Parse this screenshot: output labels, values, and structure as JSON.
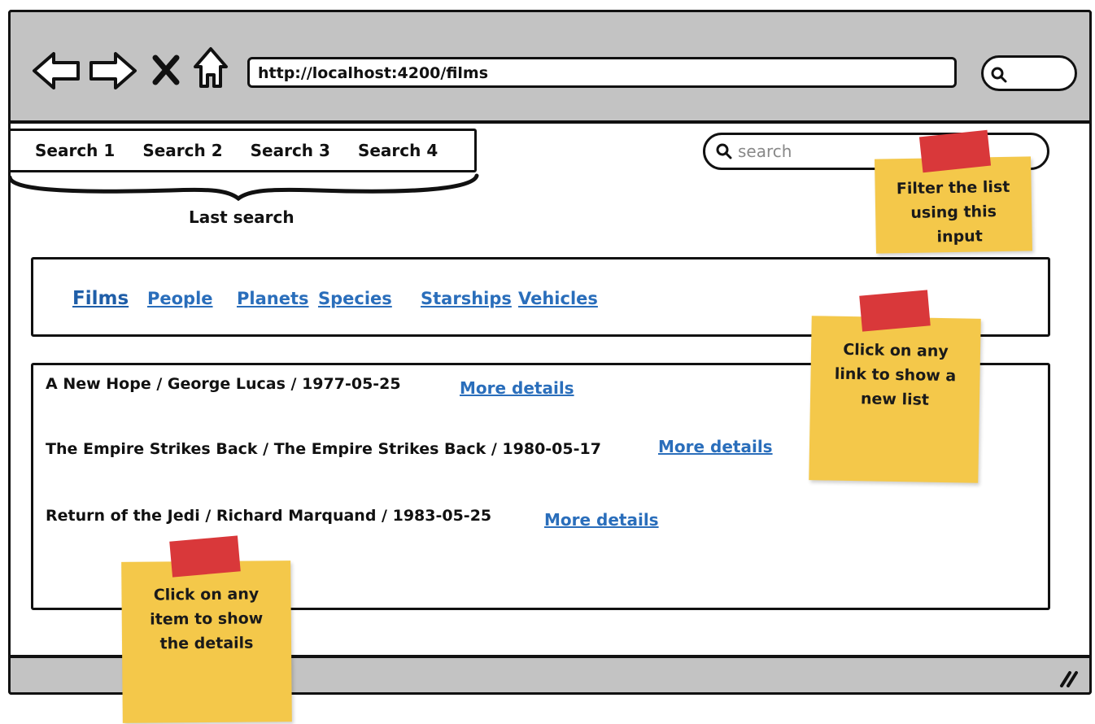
{
  "browser": {
    "url": "http://localhost:4200/films",
    "nav_icons": [
      "back-arrow-icon",
      "forward-arrow-icon",
      "stop-icon",
      "home-icon"
    ],
    "search_icon": "search-icon"
  },
  "recent_searches": {
    "items": [
      "Search 1",
      "Search 2",
      "Search 3",
      "Search 4"
    ],
    "caption": "Last search"
  },
  "search": {
    "placeholder": "search"
  },
  "categories": {
    "links": [
      "Films",
      "People",
      "Planets",
      "Species",
      "Starships",
      "Vehicles"
    ],
    "active": "Films"
  },
  "films": {
    "rows": [
      "A New Hope / George Lucas / 1977-05-25",
      "The Empire Strikes Back / The Empire Strikes Back / 1980-05-17",
      "Return of the Jedi / Richard Marquand / 1983-05-25"
    ],
    "more_label": "More details"
  },
  "notes": {
    "filter": [
      "Filter the list",
      "using this",
      "input"
    ],
    "links": [
      "Click on any",
      "link to show a",
      "new list"
    ],
    "items": [
      "Click on any",
      "item to show",
      "the details"
    ]
  },
  "colors": {
    "chrome": "#c3c3c3",
    "link": "#2a6ebb",
    "note": "#f4c84a",
    "tape": "#d9383a"
  }
}
